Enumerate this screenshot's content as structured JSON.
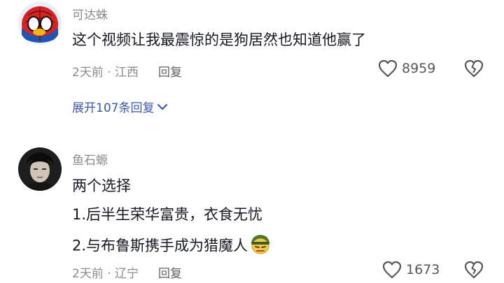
{
  "comments": [
    {
      "username": "可达蛛",
      "lines": [
        "这个视频让我最震惊的是狗居然也知道他赢了"
      ],
      "time_location": "2天前 · 江西",
      "reply_label": "回复",
      "likes": "8959",
      "avatar_icon": "spiderman-avatar",
      "expand_label": "展开107条回复"
    },
    {
      "username": "鱼石螈",
      "lines": [
        "两个选择",
        "1.后半生荣华富贵，衣食无忧",
        "2.与布鲁斯携手成为猎魔人"
      ],
      "time_location": "2天前 · 辽宁",
      "reply_label": "回复",
      "likes": "1673",
      "avatar_icon": "person-avatar",
      "trailing_emoji": "soldier-emoji"
    }
  ],
  "colors": {
    "secondary_text": "#8a8b91",
    "link_blue": "#3a57b2",
    "primary_text": "#161823"
  }
}
